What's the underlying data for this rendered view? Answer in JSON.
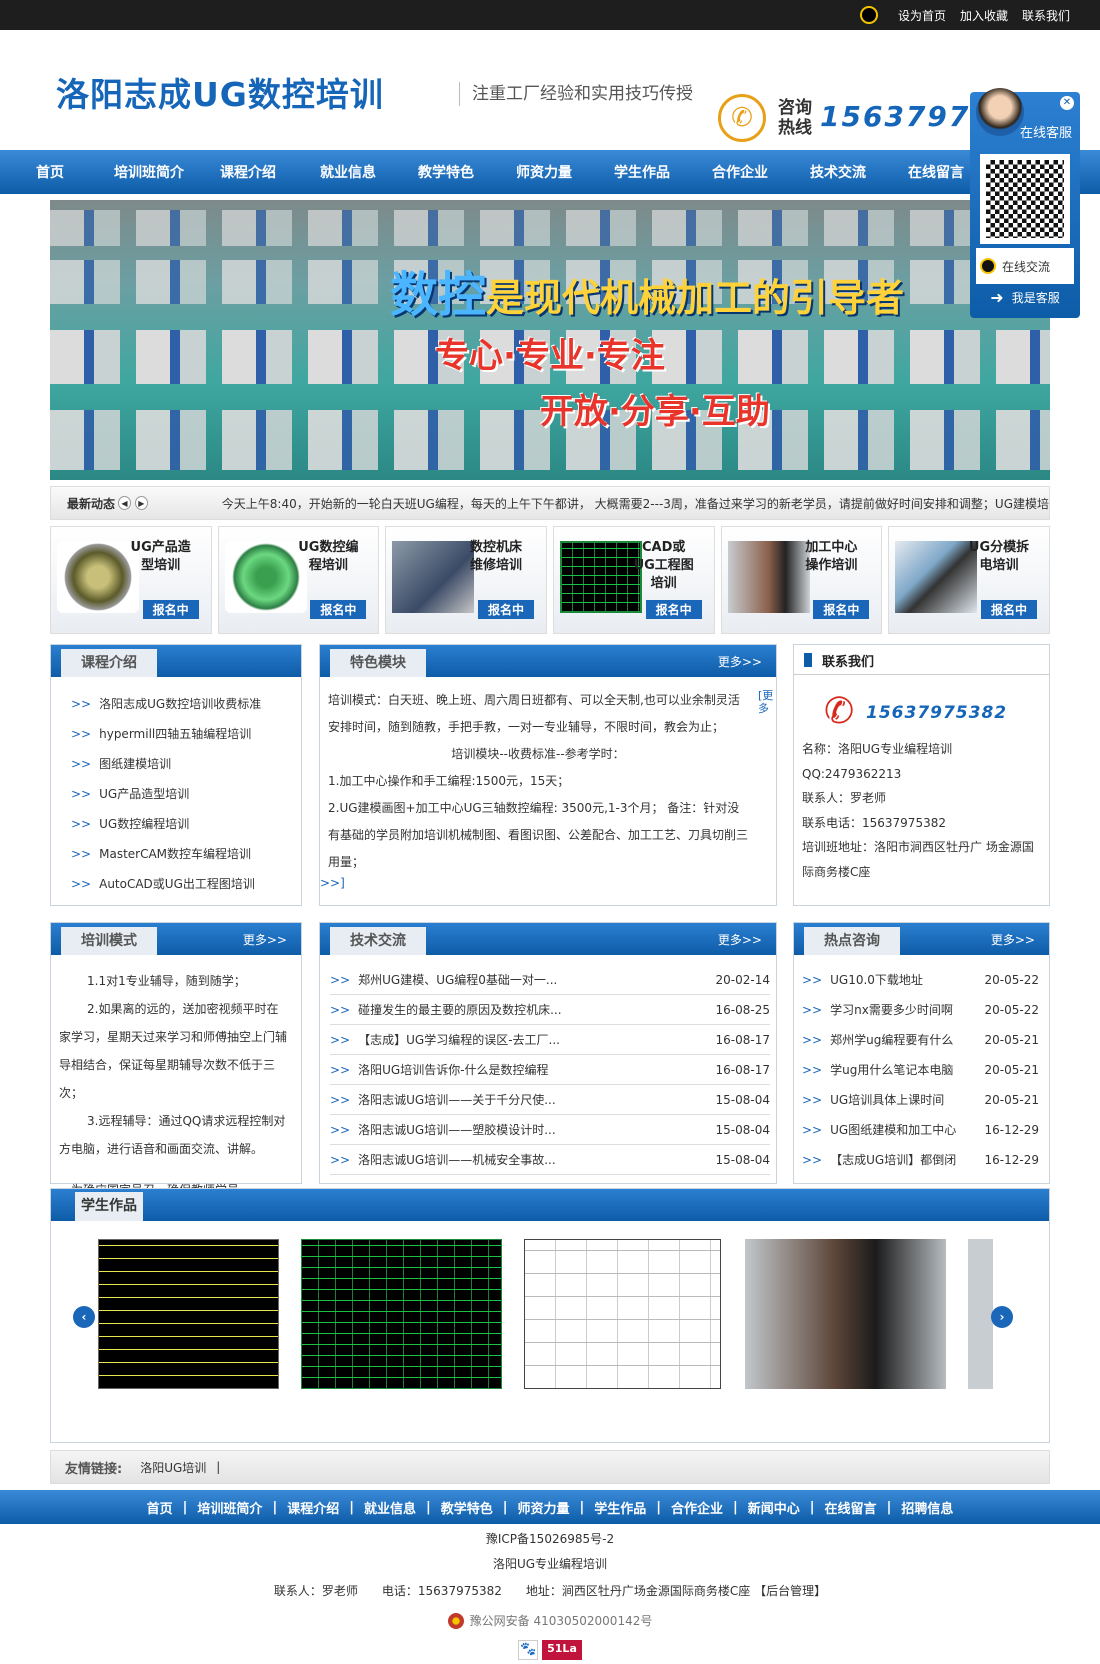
{
  "topbar": {
    "set_home": "设为首页",
    "bookmark": "加入收藏",
    "contact": "联系我们"
  },
  "header": {
    "logo": "洛阳志成UG数控培训",
    "slogan": "注重工厂经验和实用技巧传授",
    "hotline_label": "咨询热线",
    "hotline": "15637975382"
  },
  "nav": [
    "首页",
    "培训班简介",
    "课程介绍",
    "就业信息",
    "教学特色",
    "师资力量",
    "学生作品",
    "合作企业",
    "技术交流",
    "在线留言"
  ],
  "banner": {
    "line1_a": "数控",
    "line1_b": "是现代机械加工的引导者",
    "line2": "专心·专业·专注",
    "line3": "开放·分享·互助"
  },
  "news": {
    "label": "最新动态",
    "text": "今天上午8:40，开始新的一轮白天班UG编程，每天的上午下午都讲， 大概需要2---3周，准备过来学习的新老学员，请提前做好时间安排和调整；UG建模培"
  },
  "cards": [
    {
      "title": "UG产品造型培训",
      "btn": "报名中"
    },
    {
      "title": "UG数控编程培训",
      "btn": "报名中"
    },
    {
      "title": "数控机床维修培训",
      "btn": "报名中"
    },
    {
      "title": "CAD或UG工程图培训",
      "btn": "报名中"
    },
    {
      "title": "加工中心操作培训",
      "btn": "报名中"
    },
    {
      "title": "UG分模拆电培训",
      "btn": "报名中"
    }
  ],
  "courses": {
    "title": "课程介绍",
    "items": [
      "洛阳志成UG数控培训收费标准",
      "hypermill四轴五轴编程培训",
      "图纸建模培训",
      "UG产品造型培训",
      "UG数控编程培训",
      "MasterCAM数控车编程培训",
      "AutoCAD或UG出工程图培训"
    ]
  },
  "features": {
    "title": "特色模块",
    "more": "更多>>",
    "side": "[更多",
    "p1": "培训模式：白天班、晚上班、周六周日班都有、可以全天制,也可以业余制灵活安排时间，随到随教，手把手教，一对一专业辅导，不限时间，教会为止；",
    "p2": "培训模块--收费标准--参考学时：",
    "p3": "1.加工中心操作和手工编程:1500元，15天；",
    "p4": "2.UG建模画图+加工中心UG三轴数控编程: 3500元,1-3个月； 备注：针对没有基础的学员附加培训机械制图、看图识图、公差配合、加工工艺、刀具切削三用量；",
    "link": ">>]"
  },
  "contact": {
    "title": "联系我们",
    "phone": "15637975382",
    "name": "名称：洛阳UG专业编程培训",
    "qq": "QQ:2479362213",
    "person": "联系人：罗老师",
    "tel": "联系电话：15637975382",
    "address": "培训班地址：洛阳市涧西区牡丹广 场金源国际商务楼C座"
  },
  "mode": {
    "title": "培训模式",
    "more": "更多>>",
    "p1": "1.1对1专业辅导，随到随学；",
    "p2": "2.如果离的远的，送加密视频平时在家学习，星期天过来学习和师傅抽空上门辅导相结合，保证每星期辅导次数不低于三次；",
    "p3": "3.远程辅导：通过QQ请求远程控制对方电脑，进行语音和画面交流、讲解。",
    "p4": "为确应国家号召，确保教师学员..."
  },
  "tech": {
    "title": "技术交流",
    "more": "更多>>",
    "items": [
      {
        "t": "郑州UG建模、UG编程0基础一对一...",
        "d": "20-02-14"
      },
      {
        "t": "碰撞发生的最主要的原因及数控机床...",
        "d": "16-08-25"
      },
      {
        "t": "【志成】UG学习编程的误区-去工厂...",
        "d": "16-08-17"
      },
      {
        "t": "洛阳UG培训告诉你-什么是数控编程",
        "d": "16-08-17"
      },
      {
        "t": "洛阳志诚UG培训——关于千分尺使...",
        "d": "15-08-04"
      },
      {
        "t": "洛阳志诚UG培训——塑胶模设计时...",
        "d": "15-08-04"
      },
      {
        "t": "洛阳志诚UG培训——机械安全事故...",
        "d": "15-08-04"
      }
    ]
  },
  "hot": {
    "title": "热点咨询",
    "more": "更多>>",
    "items": [
      {
        "t": "UG10.0下载地址",
        "d": "20-05-22"
      },
      {
        "t": "学习nx需要多少时间啊",
        "d": "20-05-22"
      },
      {
        "t": "郑州学ug编程要有什么",
        "d": "20-05-21"
      },
      {
        "t": "学ug用什么笔记本电脑",
        "d": "20-05-21"
      },
      {
        "t": "UG培训具体上课时间",
        "d": "20-05-21"
      },
      {
        "t": "UG图纸建模和加工中心",
        "d": "16-12-29"
      },
      {
        "t": "【志成UG培训】都倒闭",
        "d": "16-12-29"
      }
    ]
  },
  "gallery": {
    "title": "学生作品"
  },
  "friends": {
    "label": "友情链接:",
    "link": "洛阳UG培训",
    "sep": "|"
  },
  "footer_nav": [
    "首页",
    "培训班简介",
    "课程介绍",
    "就业信息",
    "教学特色",
    "师资力量",
    "学生作品",
    "合作企业",
    "新闻中心",
    "在线留言",
    "招聘信息"
  ],
  "footer": {
    "icp": "豫ICP备15026985号-2",
    "name": "洛阳UG专业编程培训",
    "contact_line": "联系人：罗老师　　电话：15637975382　　地址：涧西区牡丹广场金源国际商务楼C座 【后台管理】",
    "police": "豫公网安备 41030502000142号",
    "stat": "51La"
  },
  "kefu": {
    "title": "在线客服",
    "chat": "在线交流",
    "me": "我是客服"
  }
}
